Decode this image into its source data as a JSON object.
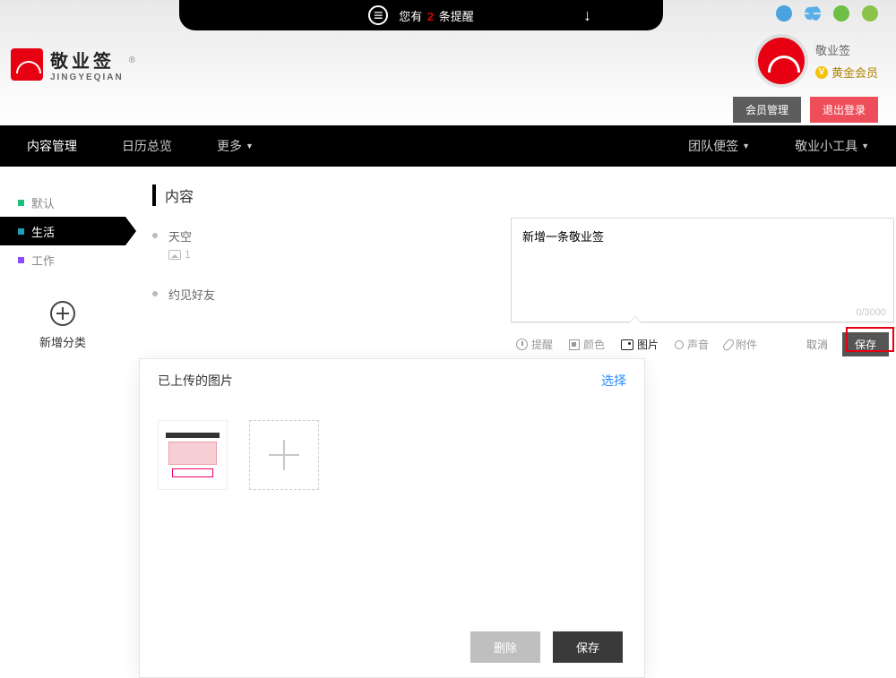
{
  "notify": {
    "pre": "您有",
    "count": "2",
    "post": "条提醒"
  },
  "brand": {
    "cn": "敬业签",
    "en": "JINGYEQIAN"
  },
  "user": {
    "name": "敬业签",
    "vip": "黄金会员"
  },
  "hdr_buttons": {
    "manage": "会员管理",
    "logout": "退出登录"
  },
  "nav": {
    "content": "内容管理",
    "calendar": "日历总览",
    "more": "更多",
    "team": "团队便签",
    "tools": "敬业小工具"
  },
  "sidebar": {
    "items": [
      "默认",
      "生活",
      "工作"
    ],
    "add": "新增分类"
  },
  "section_title": "内容",
  "notes": [
    {
      "title": "天空",
      "img_count": "1"
    },
    {
      "title": "约见好友"
    }
  ],
  "editor": {
    "value": "新增一条敬业签",
    "counter": "0/3000",
    "tools": {
      "remind": "提醒",
      "color": "颜色",
      "image": "图片",
      "sound": "声音",
      "attach": "附件"
    },
    "cancel": "取消",
    "save": "保存"
  },
  "modal": {
    "title": "已上传的图片",
    "select": "选择",
    "delete": "删除",
    "save": "保存"
  }
}
